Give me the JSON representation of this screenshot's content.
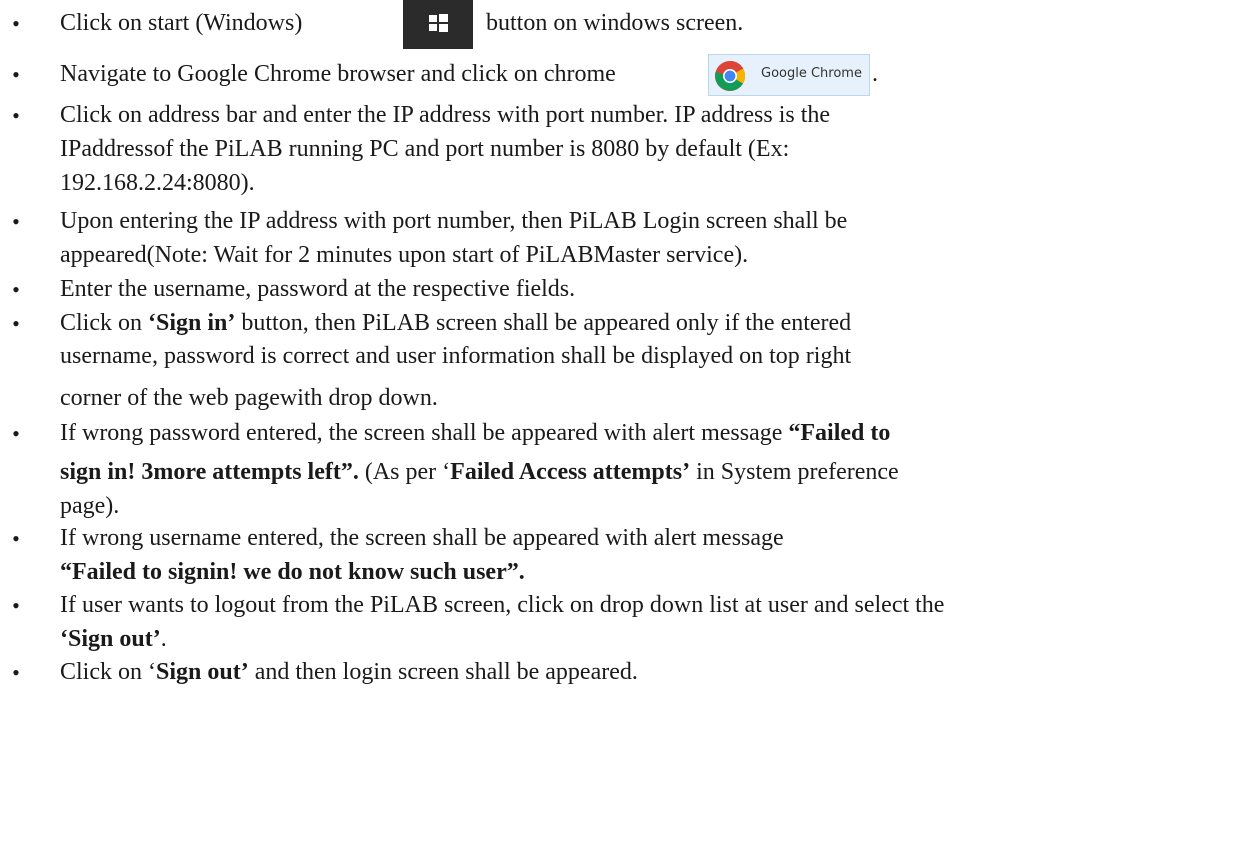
{
  "bullet_glyph": "•",
  "items": [
    {
      "lines": [
        [
          {
            "t": "Click on start (Windows)"
          }
        ],
        []
      ],
      "suffix": "button on windows screen.",
      "windows_icon": "windows-start-icon"
    },
    {
      "lines": [
        [
          {
            "t": "Navigate to Google Chrome browser and click on chrome"
          }
        ]
      ],
      "chip_label": "Google Chrome",
      "end_punct": ".",
      "chrome_icon": "chrome-logo-icon"
    },
    {
      "lines": [
        [
          {
            "t": "Click on address bar and enter the IP address with port number. IP address is the"
          }
        ],
        [
          {
            "t": "IPaddressof the PiLAB running PC and port number is 8080 by default (Ex:"
          }
        ],
        [
          {
            "t": "192.168.2.24:8080)."
          }
        ]
      ]
    },
    {
      "lines": [
        [
          {
            "t": "Upon entering the IP address with port number, then PiLAB Login screen shall be"
          }
        ],
        [
          {
            "t": "appeared(Note: Wait for 2 minutes upon start of PiLABMaster service)."
          }
        ]
      ]
    },
    {
      "lines": [
        [
          {
            "t": "Enter the username, password at the respective fields."
          }
        ]
      ]
    },
    {
      "lines": [
        [
          {
            "t": "Click on "
          },
          {
            "t": "‘Sign in’",
            "b": true
          },
          {
            "t": " button, then PiLAB screen shall be appeared only if the entered"
          }
        ],
        [
          {
            "t": "username, password is correct and user information shall be displayed on top right"
          }
        ],
        [
          {
            "t": "corner of the web pagewith drop down."
          }
        ]
      ]
    },
    {
      "lines": [
        [
          {
            "t": "If wrong password entered, the screen shall be appeared with alert message "
          },
          {
            "t": "“Failed to",
            "b": true
          }
        ],
        [
          {
            "t": "sign in! 3more attempts left”.",
            "b": true
          },
          {
            "t": " (As per ‘"
          },
          {
            "t": "Failed Access attempts’",
            "b": true
          },
          {
            "t": " in System preference"
          }
        ],
        [
          {
            "t": "page)."
          }
        ]
      ]
    },
    {
      "lines": [
        [
          {
            "t": "If wrong username entered, the screen shall be appeared with alert message"
          }
        ],
        [
          {
            "t": "“Failed to signin! we do not know such user”.",
            "b": true
          }
        ]
      ]
    },
    {
      "lines": [
        [
          {
            "t": "If user wants to logout from the PiLAB screen, click on drop down list at user and select the"
          }
        ],
        [
          {
            "t": "‘Sign out’",
            "b": true
          },
          {
            "t": "."
          }
        ]
      ]
    },
    {
      "lines": [
        [
          {
            "t": "Click on ‘"
          },
          {
            "t": "Sign out’",
            "b": true
          },
          {
            "t": " and then login screen shall be appeared."
          }
        ]
      ]
    }
  ]
}
